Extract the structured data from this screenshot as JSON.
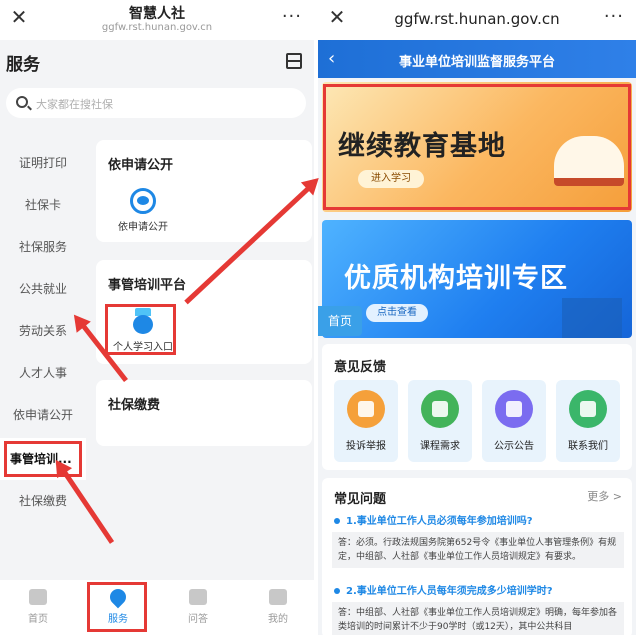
{
  "left": {
    "browser": {
      "title": "智慧人社",
      "url": "ggfw.rst.hunan.gov.cn",
      "close_icon": "close-icon",
      "more": "···"
    },
    "page_title": "服务",
    "search_placeholder": "大家都在搜社保",
    "sidebar": [
      {
        "label": "证明打印"
      },
      {
        "label": "社保卡"
      },
      {
        "label": "社保服务"
      },
      {
        "label": "公共就业"
      },
      {
        "label": "劳动关系"
      },
      {
        "label": "人才人事"
      },
      {
        "label": "依申请公开"
      },
      {
        "label": "事管培训..."
      },
      {
        "label": "社保缴费"
      }
    ],
    "cards": [
      {
        "title": "依申请公开",
        "item_label": "依申请公开",
        "icon": "eye-icon"
      },
      {
        "title": "事管培训平台",
        "item_label": "个人学习入口",
        "icon": "medal-icon"
      },
      {
        "title": "社保缴费"
      }
    ],
    "bottom_nav": [
      {
        "label": "首页",
        "icon": "home-icon"
      },
      {
        "label": "服务",
        "icon": "service-icon"
      },
      {
        "label": "问答",
        "icon": "chat-icon"
      },
      {
        "label": "我的",
        "icon": "user-icon"
      }
    ],
    "highlight_color": "#e53935"
  },
  "right": {
    "browser": {
      "url": "ggfw.rst.hunan.gov.cn",
      "more": "···"
    },
    "header_title": "事业单位培训监督服务平台",
    "banner1": {
      "title": "继续教育基地",
      "button": "进入学习"
    },
    "banner2": {
      "title": "优质机构培训专区",
      "button": "点击查看"
    },
    "home_badge": "首页",
    "feedback": {
      "title": "意见反馈",
      "items": [
        {
          "label": "投诉举报",
          "color": "#f5a03a"
        },
        {
          "label": "课程需求",
          "color": "#43b35a"
        },
        {
          "label": "公示公告",
          "color": "#7b6cf0"
        },
        {
          "label": "联系我们",
          "color": "#3bb66a"
        }
      ]
    },
    "faq": {
      "title": "常见问题",
      "more": "更多 >",
      "items": [
        {
          "q": "1.事业单位工作人员必须每年参加培训吗?",
          "a": "答：必须。行政法规国务院第652号令《事业单位人事管理条例》有规定，中组部、人社部《事业单位工作人员培训规定》有要求。"
        },
        {
          "q": "2.事业单位工作人员每年须完成多少培训学时?",
          "a": "答：中组部、人社部《事业单位工作人员培训规定》明确，每年参加各类培训的时间累计不少于90学时（或12天），其中公共科目"
        }
      ]
    },
    "accent": "#1e6fd6"
  }
}
